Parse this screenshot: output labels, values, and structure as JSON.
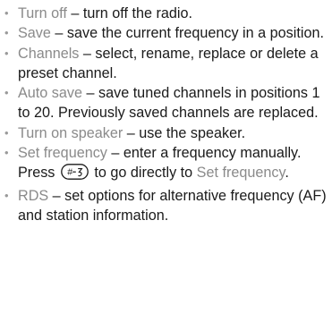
{
  "items": [
    {
      "term": "Turn off",
      "text": " – turn off the radio."
    },
    {
      "term": "Save",
      "text": " – save the current frequency in a position."
    },
    {
      "term": "Channels",
      "text": " – select, rename, replace or delete a preset channel."
    },
    {
      "term": "Auto save",
      "text": " – save tuned channels in positions 1 to 20. Previously saved channels are replaced."
    },
    {
      "term": "Turn on speaker",
      "text": " – use the speaker."
    },
    {
      "term": "Set frequency",
      "text_before_key": " – enter a frequency manually. Press ",
      "key_icon": "hash-key-icon",
      "text_after_key": " to go directly to ",
      "term_end": "Set frequency",
      "text_end": "."
    },
    {
      "term": "RDS",
      "text": " – set options for alternative frequency (AF) and station information."
    }
  ]
}
